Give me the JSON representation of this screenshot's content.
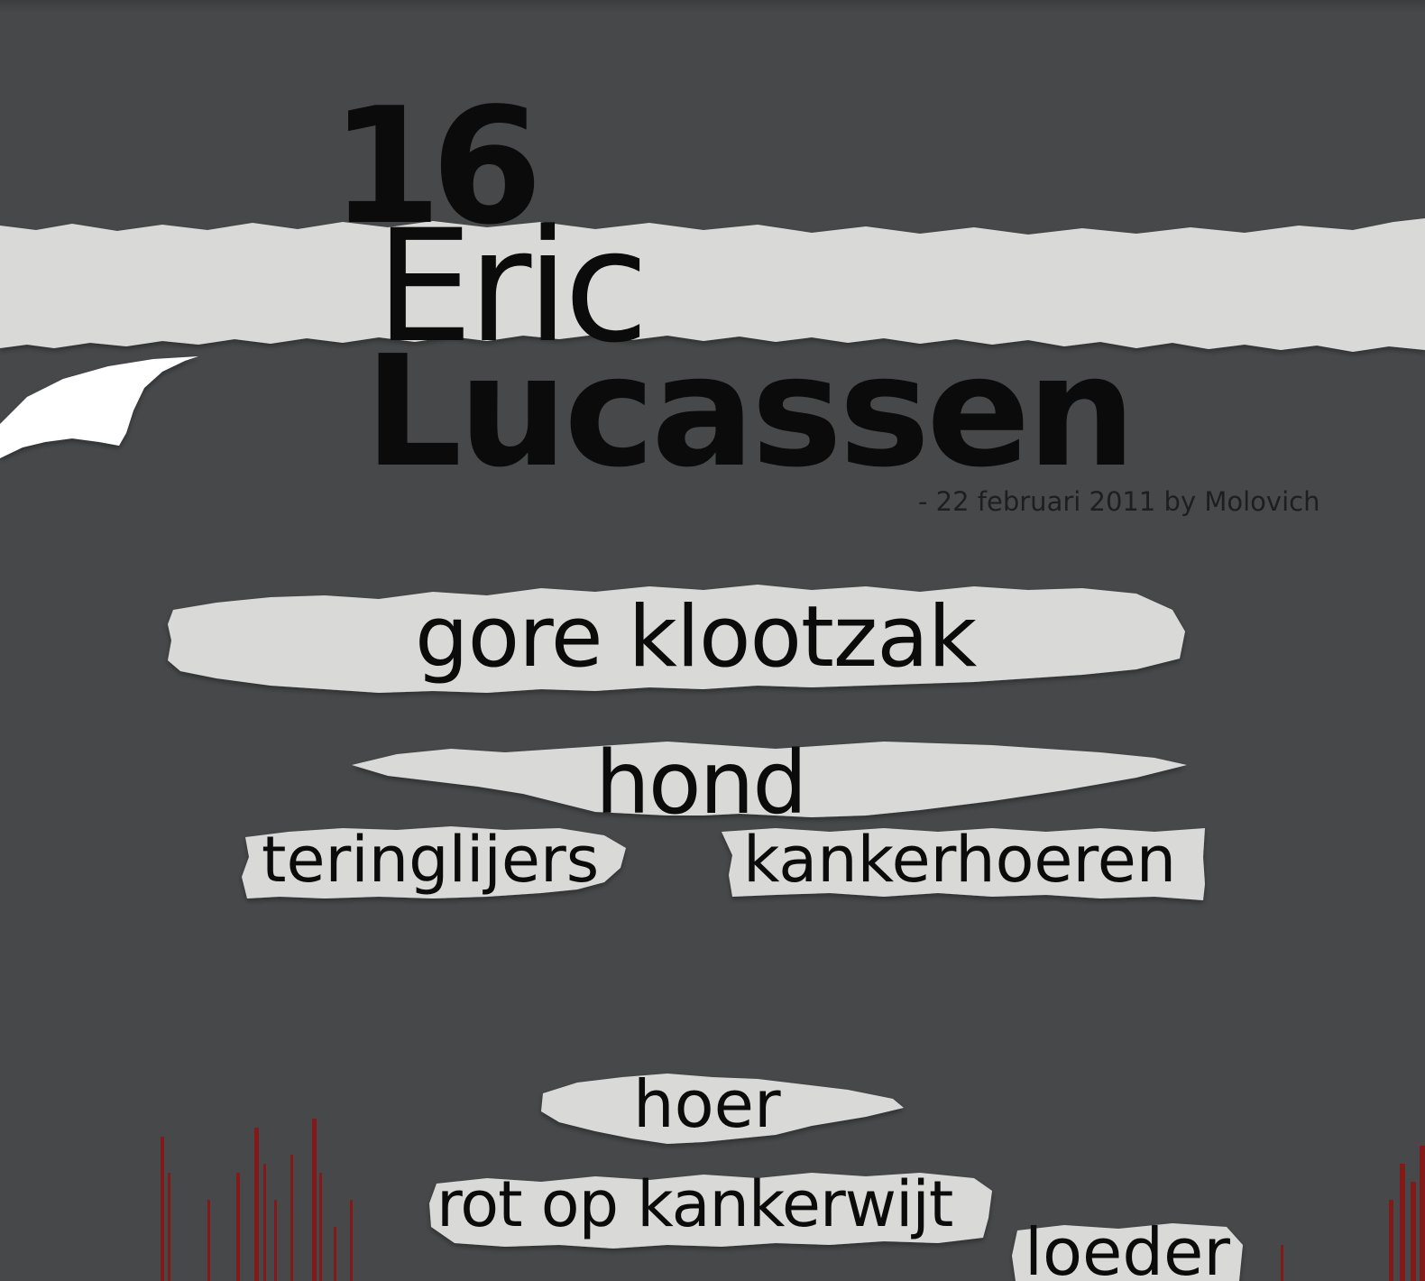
{
  "poster": {
    "number": "16",
    "first_name": "Eric",
    "last_name": "Lucassen",
    "byline": "- 22 februari 2011 by Molovich"
  },
  "words": [
    "gore klootzak",
    "hond",
    "teringlijers",
    "kankerhoeren",
    "hoer",
    "rot op kankerwijt",
    "loeder"
  ],
  "colors": {
    "background": "#47484a",
    "paper": "#d9dad8",
    "paper_curl": "#ffffff",
    "text": "#0b0b0b",
    "blood": "#8a1414"
  }
}
